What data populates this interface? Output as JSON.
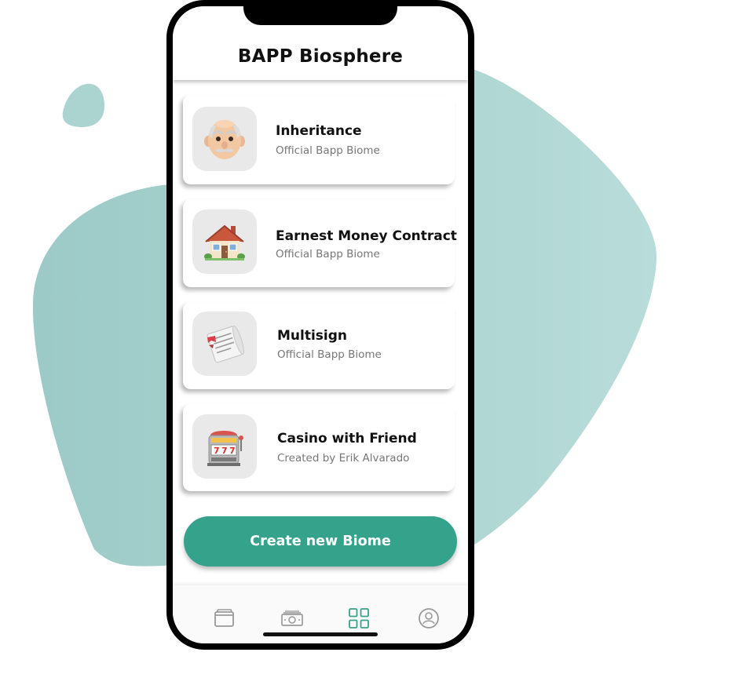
{
  "app": {
    "title": "BAPP Biosphere"
  },
  "biomes": [
    {
      "title": "Inheritance",
      "subtitle": "Official Bapp Biome",
      "icon": "old-man-icon"
    },
    {
      "title": "Earnest Money Contract",
      "subtitle": "Official Bapp Biome",
      "icon": "house-icon"
    },
    {
      "title": "Multisign",
      "subtitle": "Official Bapp Biome",
      "icon": "document-scroll-icon"
    },
    {
      "title": "Casino with Friend",
      "subtitle": "Created by Erik Alvarado",
      "icon": "slot-machine-icon"
    }
  ],
  "actions": {
    "create_label": "Create new Biome"
  },
  "tab_bar": {
    "items": [
      {
        "icon": "wallet-icon",
        "active": false
      },
      {
        "icon": "money-icon",
        "active": false
      },
      {
        "icon": "grid-icon",
        "active": true
      },
      {
        "icon": "profile-icon",
        "active": false
      }
    ]
  },
  "colors": {
    "accent": "#35a28b",
    "blob": "#acd6d2",
    "active_tab": "#35a28b",
    "inactive_tab": "#999999"
  }
}
